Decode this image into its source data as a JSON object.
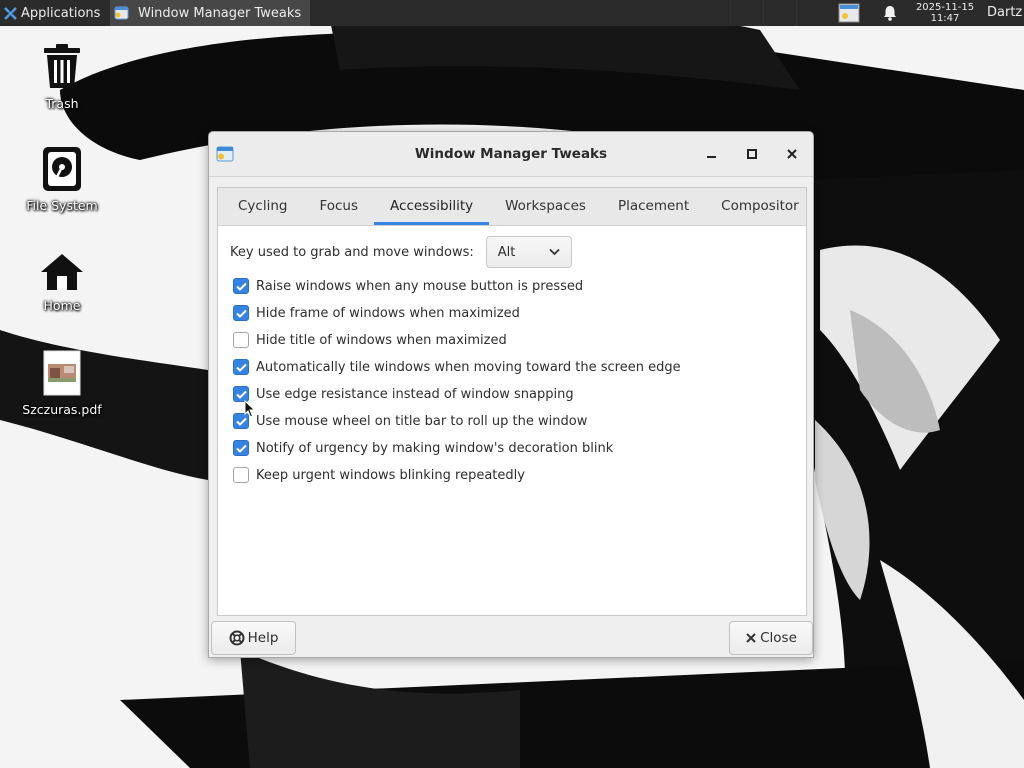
{
  "panel": {
    "applications_label": "Applications",
    "taskbar_item": "Window Manager Tweaks",
    "clock_date": "2025-11-15",
    "clock_time": "11:47",
    "user": "Dartz"
  },
  "desktop": {
    "icons": [
      {
        "label": "Trash",
        "icon": "trash-icon"
      },
      {
        "label": "File System",
        "icon": "hard-drive-icon"
      },
      {
        "label": "Home",
        "icon": "home-icon"
      },
      {
        "label": "Szczuras.pdf",
        "icon": "pdf-thumbnail-icon"
      }
    ]
  },
  "dialog": {
    "title": "Window Manager Tweaks",
    "tabs": [
      {
        "label": "Cycling",
        "active": false
      },
      {
        "label": "Focus",
        "active": false
      },
      {
        "label": "Accessibility",
        "active": true
      },
      {
        "label": "Workspaces",
        "active": false
      },
      {
        "label": "Placement",
        "active": false
      },
      {
        "label": "Compositor",
        "active": false
      }
    ],
    "key_label": "Key used to grab and move windows:",
    "key_value": "Alt",
    "options": [
      {
        "label": "Raise windows when any mouse button is pressed",
        "checked": true
      },
      {
        "label": "Hide frame of windows when maximized",
        "checked": true
      },
      {
        "label": "Hide title of windows when maximized",
        "checked": false
      },
      {
        "label": "Automatically tile windows when moving toward the screen edge",
        "checked": true
      },
      {
        "label": "Use edge resistance instead of window snapping",
        "checked": true
      },
      {
        "label": "Use mouse wheel on title bar to roll up the window",
        "checked": true
      },
      {
        "label": "Notify of urgency by making window's decoration blink",
        "checked": true
      },
      {
        "label": "Keep urgent windows blinking repeatedly",
        "checked": false
      }
    ],
    "help_label": "Help",
    "close_label": "Close"
  },
  "colors": {
    "accent": "#3584e4",
    "panel_bg": "#2b2b2b",
    "active_task_bg": "#474747"
  }
}
